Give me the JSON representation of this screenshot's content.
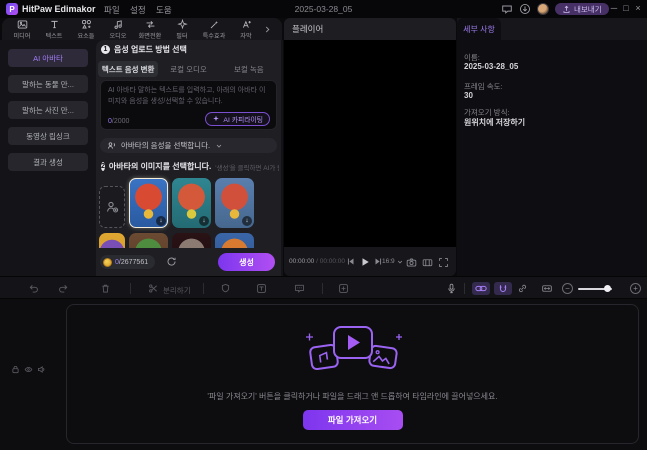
{
  "titlebar": {
    "app_name": "HitPaw Edimakor",
    "menus": [
      "파일",
      "설정",
      "도움"
    ],
    "document_title": "2025-03-28_05",
    "export_label": "내보내기",
    "window_controls": {
      "minimize": "─",
      "maximize": "□",
      "close": "×"
    }
  },
  "ribbon": {
    "tabs": [
      {
        "label": "미디어",
        "icon": "media-icon"
      },
      {
        "label": "텍스트",
        "icon": "text-icon"
      },
      {
        "label": "요소들",
        "icon": "elements-icon"
      },
      {
        "label": "오디오",
        "icon": "audio-icon"
      },
      {
        "label": "화면전환",
        "icon": "transition-icon"
      },
      {
        "label": "필터",
        "icon": "filter-icon"
      },
      {
        "label": "특수효과",
        "icon": "effects-icon"
      },
      {
        "label": "자막",
        "icon": "subtitle-icon"
      }
    ]
  },
  "sidebar": {
    "items": [
      {
        "label": "AI 아바타",
        "active": true
      },
      {
        "label": "말하는 동물 만...",
        "active": false
      },
      {
        "label": "말하는 사진 만...",
        "active": false
      },
      {
        "label": "동영상 립싱크",
        "active": false
      },
      {
        "label": "결과 생성",
        "active": false
      }
    ]
  },
  "avatar_panel": {
    "step1": {
      "number": "1",
      "title": "음성 업로드 방법 선택"
    },
    "upload_tabs": [
      {
        "label": "텍스트 음성 변환",
        "active": true
      },
      {
        "label": "로컬 오디오",
        "active": false
      },
      {
        "label": "보컬 녹음",
        "active": false
      }
    ],
    "text_input": {
      "placeholder": "AI 아바타 말하는 텍스트를 입력하고, 아래의 아바타 이미지와 음성을 생성/선택할 수 있습니다.",
      "count_current": "0",
      "count_max": "/2000"
    },
    "ai_copywriting_label": "AI 카피라이팅",
    "voice_select_label": "아바타의 음성을 선택합니다.",
    "step2": {
      "number": "2",
      "title": "아바타의 이미지를 선택합니다.",
      "hint": "'생성'을 클릭하면 AI가 립싱크한 비"
    },
    "avatars": [
      {
        "desc": "clown-red-hair-blue-bg",
        "selected": true,
        "hair": "#d84a32",
        "bg": "#3a74c4",
        "bg2": "#2a5aa0",
        "accent": "#e8b83a"
      },
      {
        "desc": "clown-red-hair-teal-bg",
        "selected": false,
        "hair": "#d4583a",
        "bg": "#2f8691",
        "bg2": "#246b74",
        "accent": "#d8c93f"
      },
      {
        "desc": "clown-girl-pom-hair",
        "selected": false,
        "hair": "#d1503c",
        "bg": "#5a7fae",
        "bg2": "#46688f",
        "accent": "#e8b83a"
      },
      {
        "desc": "purple-fluff-yellow-bg",
        "selected": false,
        "hair": "#7a4fb5",
        "bg": "#e0a832",
        "bg2": "#c98f20",
        "accent": "#e8d85a"
      },
      {
        "desc": "green-wreath-brown-bg",
        "selected": false,
        "hair": "#4e8c3f",
        "bg": "#6b4a32",
        "bg2": "#543823",
        "accent": "#8a6a4a"
      },
      {
        "desc": "hamster-red-ears",
        "selected": false,
        "hair": "#8a7a72",
        "bg": "#2a1215",
        "bg2": "#1c0c0e",
        "accent": "#c23a3a"
      },
      {
        "desc": "orange-fox-blue-bg",
        "selected": false,
        "hair": "#d87a30",
        "bg": "#3a66a8",
        "bg2": "#2c4f88",
        "accent": "#e8c84a"
      }
    ],
    "credits": {
      "current": "0",
      "max": "/2677561"
    },
    "generate_label": "생성"
  },
  "player": {
    "title": "플레이어",
    "time_current": "00:00:00",
    "time_separator": " / ",
    "time_total": "00:00:00",
    "aspect_ratio": "16:9"
  },
  "details": {
    "tab_label": "세부 사항",
    "fields": [
      {
        "label": "이름:",
        "value": "2025-03-28_05"
      },
      {
        "label": "프레임 속도:",
        "value": "30"
      },
      {
        "label": "가져오기 방식:",
        "value": "원위치에 저장하기"
      }
    ]
  },
  "edit_toolbar": {
    "split_label": "분리하기"
  },
  "timeline": {
    "drop_hint": "'파일 가져오기' 버튼을 클릭하거나 파일을 드래그 앤 드롭하여 타임라인에 끌어넣으세요.",
    "import_label": "파일 가져오기"
  },
  "colors": {
    "accent": "#9b5cf5",
    "accent_light": "#b18cf5",
    "button_gradient_start": "#7d36ee",
    "button_gradient_end": "#b14ff2",
    "export_button_bg": "#463066",
    "coin": "#e8b53a",
    "selected_border": "#f5edd8"
  }
}
